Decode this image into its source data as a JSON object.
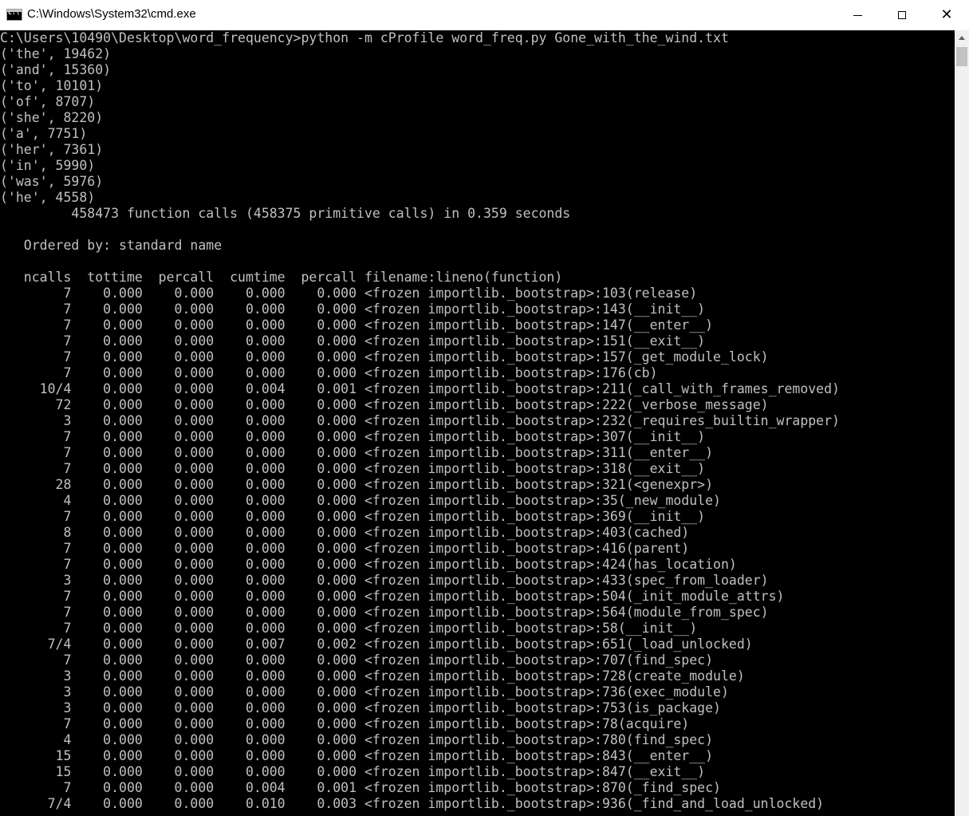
{
  "window": {
    "title": "C:\\Windows\\System32\\cmd.exe",
    "icon": "console-icon",
    "controls": {
      "minimize": "minimize-icon",
      "maximize": "maximize-icon",
      "close": "close-icon"
    }
  },
  "console": {
    "lines": [
      "C:\\Users\\10490\\Desktop\\word_frequency>python -m cProfile word_freq.py Gone_with_the_wind.txt",
      "('the', 19462)",
      "('and', 15360)",
      "('to', 10101)",
      "('of', 8707)",
      "('she', 8220)",
      "('a', 7751)",
      "('her', 7361)",
      "('in', 5990)",
      "('was', 5976)",
      "('he', 4558)",
      "         458473 function calls (458375 primitive calls) in 0.359 seconds",
      "",
      "   Ordered by: standard name",
      "",
      "   ncalls  tottime  percall  cumtime  percall filename:lineno(function)",
      "        7    0.000    0.000    0.000    0.000 <frozen importlib._bootstrap>:103(release)",
      "        7    0.000    0.000    0.000    0.000 <frozen importlib._bootstrap>:143(__init__)",
      "        7    0.000    0.000    0.000    0.000 <frozen importlib._bootstrap>:147(__enter__)",
      "        7    0.000    0.000    0.000    0.000 <frozen importlib._bootstrap>:151(__exit__)",
      "        7    0.000    0.000    0.000    0.000 <frozen importlib._bootstrap>:157(_get_module_lock)",
      "        7    0.000    0.000    0.000    0.000 <frozen importlib._bootstrap>:176(cb)",
      "     10/4    0.000    0.000    0.004    0.001 <frozen importlib._bootstrap>:211(_call_with_frames_removed)",
      "       72    0.000    0.000    0.000    0.000 <frozen importlib._bootstrap>:222(_verbose_message)",
      "        3    0.000    0.000    0.000    0.000 <frozen importlib._bootstrap>:232(_requires_builtin_wrapper)",
      "        7    0.000    0.000    0.000    0.000 <frozen importlib._bootstrap>:307(__init__)",
      "        7    0.000    0.000    0.000    0.000 <frozen importlib._bootstrap>:311(__enter__)",
      "        7    0.000    0.000    0.000    0.000 <frozen importlib._bootstrap>:318(__exit__)",
      "       28    0.000    0.000    0.000    0.000 <frozen importlib._bootstrap>:321(<genexpr>)",
      "        4    0.000    0.000    0.000    0.000 <frozen importlib._bootstrap>:35(_new_module)",
      "        7    0.000    0.000    0.000    0.000 <frozen importlib._bootstrap>:369(__init__)",
      "        8    0.000    0.000    0.000    0.000 <frozen importlib._bootstrap>:403(cached)",
      "        7    0.000    0.000    0.000    0.000 <frozen importlib._bootstrap>:416(parent)",
      "        7    0.000    0.000    0.000    0.000 <frozen importlib._bootstrap>:424(has_location)",
      "        3    0.000    0.000    0.000    0.000 <frozen importlib._bootstrap>:433(spec_from_loader)",
      "        7    0.000    0.000    0.000    0.000 <frozen importlib._bootstrap>:504(_init_module_attrs)",
      "        7    0.000    0.000    0.000    0.000 <frozen importlib._bootstrap>:564(module_from_spec)",
      "        7    0.000    0.000    0.000    0.000 <frozen importlib._bootstrap>:58(__init__)",
      "      7/4    0.000    0.000    0.007    0.002 <frozen importlib._bootstrap>:651(_load_unlocked)",
      "        7    0.000    0.000    0.000    0.000 <frozen importlib._bootstrap>:707(find_spec)",
      "        3    0.000    0.000    0.000    0.000 <frozen importlib._bootstrap>:728(create_module)",
      "        3    0.000    0.000    0.000    0.000 <frozen importlib._bootstrap>:736(exec_module)",
      "        3    0.000    0.000    0.000    0.000 <frozen importlib._bootstrap>:753(is_package)",
      "        7    0.000    0.000    0.000    0.000 <frozen importlib._bootstrap>:78(acquire)",
      "        4    0.000    0.000    0.000    0.000 <frozen importlib._bootstrap>:780(find_spec)",
      "       15    0.000    0.000    0.000    0.000 <frozen importlib._bootstrap>:843(__enter__)",
      "       15    0.000    0.000    0.000    0.000 <frozen importlib._bootstrap>:847(__exit__)",
      "        7    0.000    0.000    0.004    0.001 <frozen importlib._bootstrap>:870(_find_spec)",
      "      7/4    0.000    0.000    0.010    0.003 <frozen importlib._bootstrap>:936(_find_and_load_unlocked)"
    ]
  },
  "colors": {
    "console_bg": "#000000",
    "console_text": "#c0c0c0",
    "titlebar_bg": "#ffffff"
  }
}
